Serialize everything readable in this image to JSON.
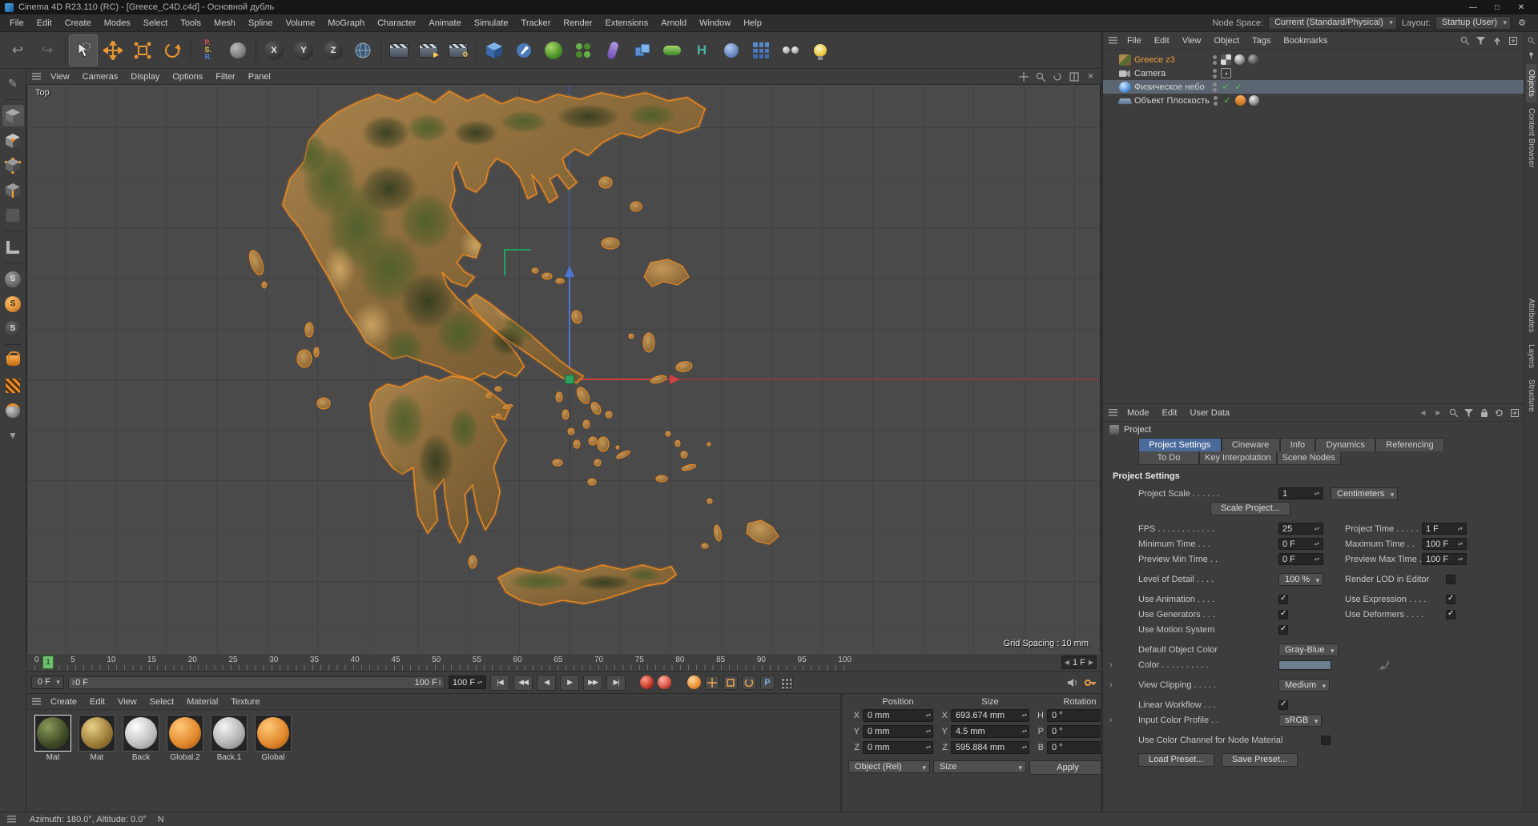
{
  "title_bar": {
    "title": "Cinema 4D R23.110 (RC) - [Greece_C4D.c4d] - Основной дубль",
    "window_controls": {
      "minimize": "—",
      "maximize": "□",
      "close": "✕"
    }
  },
  "menu_bar": {
    "items": [
      "File",
      "Edit",
      "Create",
      "Modes",
      "Select",
      "Tools",
      "Mesh",
      "Spline",
      "Volume",
      "MoGraph",
      "Character",
      "Animate",
      "Simulate",
      "Tracker",
      "Render",
      "Extensions",
      "Arnold",
      "Window",
      "Help"
    ],
    "node_space_label": "Node Space:",
    "node_space_value": "Current (Standard/Physical)",
    "layout_label": "Layout:",
    "layout_value": "Startup (User)"
  },
  "icons": {
    "undo": "↩",
    "redo": "↪",
    "x_axis": "X",
    "y_axis": "Y",
    "z_axis": "Z",
    "gear": "⚙",
    "hair": "H",
    "snap": "S",
    "parameter": "P",
    "pencil": "✎",
    "down_arrow": "▼",
    "close": "✕",
    "left_arrow": "◀",
    "right_arrow": "▶"
  },
  "viewport": {
    "menus": [
      "View",
      "Cameras",
      "Display",
      "Options",
      "Filter",
      "Panel"
    ],
    "view_label": "Top",
    "grid_spacing": "Grid Spacing : 10 mm"
  },
  "timeline": {
    "ticks": [
      "0",
      "5",
      "10",
      "15",
      "20",
      "25",
      "30",
      "35",
      "40",
      "45",
      "50",
      "55",
      "60",
      "65",
      "70",
      "75",
      "80",
      "85",
      "90",
      "95",
      "100"
    ],
    "playhead": "1",
    "current_frame": "1 F"
  },
  "transport": {
    "range_dropdown": "0 F",
    "range_start": "0 F",
    "range_end": "100 F",
    "end_spinner": "100 F",
    "buttons": [
      "|◀",
      "◀◀",
      "◀",
      "▶",
      "▶▶",
      "▶|"
    ]
  },
  "materials": {
    "menus": [
      "Create",
      "Edit",
      "View",
      "Select",
      "Material",
      "Texture"
    ],
    "items": [
      {
        "name": "Mat"
      },
      {
        "name": "Mat"
      },
      {
        "name": "Back"
      },
      {
        "name": "Global.2"
      },
      {
        "name": "Back.1"
      },
      {
        "name": "Global"
      }
    ]
  },
  "coordinates": {
    "headers": [
      "Position",
      "Size",
      "Rotation"
    ],
    "rows": [
      {
        "axis": "X",
        "position": "0 mm",
        "size_axis": "X",
        "size": "693.674 mm",
        "rot_axis": "H",
        "rotation": "0 °"
      },
      {
        "axis": "Y",
        "position": "0 mm",
        "size_axis": "Y",
        "size": "4.5 mm",
        "rot_axis": "P",
        "rotation": "0 °"
      },
      {
        "axis": "Z",
        "position": "0 mm",
        "size_axis": "Z",
        "size": "595.884 mm",
        "rot_axis": "B",
        "rotation": "0 °"
      }
    ],
    "object_mode": "Object (Rel)",
    "size_mode": "Size",
    "apply": "Apply"
  },
  "object_manager": {
    "menus": [
      "File",
      "Edit",
      "View",
      "Object",
      "Tags",
      "Bookmarks"
    ],
    "objects": [
      {
        "name": "Greece z3"
      },
      {
        "name": "Camera"
      },
      {
        "name": "Физическое небо"
      },
      {
        "name": "Объект Плоскость"
      }
    ]
  },
  "attributes": {
    "menus": [
      "Mode",
      "Edit",
      "User Data"
    ],
    "breadcrumb": "Project",
    "tabs1": [
      "Project Settings",
      "Cineware",
      "Info",
      "Dynamics",
      "Referencing"
    ],
    "tabs2": [
      "To Do",
      "Key Interpolation",
      "Scene Nodes"
    ],
    "section_title": "Project Settings",
    "fields": {
      "project_scale_label": "Project Scale . . . . . .",
      "project_scale_value": "1",
      "project_scale_unit": "Centimeters",
      "scale_project_button": "Scale Project...",
      "fps_label": "FPS . . . . . . . . . . . .",
      "fps_value": "25",
      "project_time_label": "Project Time . . . . .",
      "project_time_value": "1 F",
      "minimum_time_label": "Minimum Time . . .",
      "minimum_time_value": "0 F",
      "maximum_time_label": "Maximum Time . .",
      "maximum_time_value": "100 F",
      "preview_min_label": "Preview Min Time . .",
      "preview_min_value": "0 F",
      "preview_max_label": "Preview Max Time .",
      "preview_max_value": "100 F",
      "lod_label": "Level of Detail . . . .",
      "lod_value": "100 %",
      "render_lod_label": "Render LOD in Editor",
      "use_animation_label": "Use Animation . . . .",
      "use_expression_label": "Use Expression . . . .",
      "use_generators_label": "Use Generators . . .",
      "use_deformers_label": "Use Deformers . . . .",
      "use_motion_label": "Use Motion System",
      "default_color_label": "Default Object Color",
      "default_color_value": "Gray-Blue",
      "color_label": "Color . . . . . . . . . .",
      "view_clipping_label": "View Clipping . . . . .",
      "view_clipping_value": "Medium",
      "linear_workflow_label": "Linear Workflow . . .",
      "input_profile_label": "Input Color Profile . .",
      "input_profile_value": "sRGB",
      "use_color_channel_label": "Use Color Channel for Node Material",
      "load_preset_button": "Load Preset...",
      "save_preset_button": "Save Preset..."
    },
    "checks": {
      "render_lod": false,
      "use_animation": true,
      "use_expression": true,
      "use_generators": true,
      "use_deformers": true,
      "use_motion": true,
      "linear_workflow": true,
      "use_color_channel": false
    }
  },
  "right_dock": {
    "tabs_top": [
      "Objects",
      "Content Browser"
    ],
    "tabs_bottom": [
      "Attributes",
      "Layers",
      "Structure"
    ]
  },
  "status_bar": {
    "text": "Azimuth: 180.0°, Altitude: 0.0°",
    "compass": "N"
  }
}
